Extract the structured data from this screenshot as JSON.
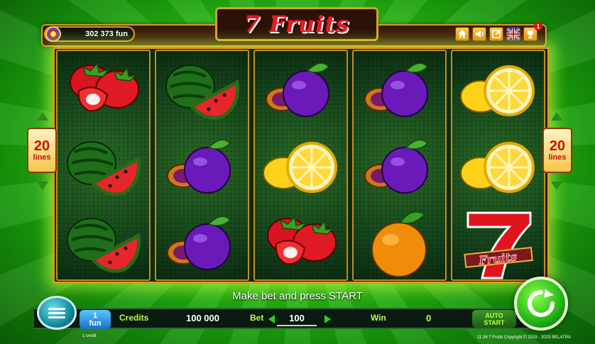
{
  "game": {
    "logo": "7 Fruits",
    "balance": "302 373 fun"
  },
  "toolbar": {
    "icons": [
      "home-icon",
      "sound-icon",
      "fullscreen-icon",
      "flag-uk-icon",
      "trophy-icon"
    ],
    "trophy_badge": "1"
  },
  "lines": {
    "left_count": "20",
    "left_label": "lines",
    "right_count": "20",
    "right_label": "lines"
  },
  "reels": [
    [
      "strawberry",
      "watermelon",
      "watermelon"
    ],
    [
      "watermelon",
      "plum",
      "plum"
    ],
    [
      "plum",
      "lemon",
      "strawberry"
    ],
    [
      "plum",
      "plum",
      "orange"
    ],
    [
      "lemon",
      "lemon",
      "seven"
    ]
  ],
  "message": "Make bet and press START",
  "bottom": {
    "coin_value": "1",
    "coin_unit": "fun",
    "credits_label": "Credits",
    "credits_value": "100 000",
    "bet_label": "Bet",
    "bet_value": "100",
    "win_label": "Win",
    "win_value": "0",
    "auto_start_line1": "AUTO",
    "auto_start_line2": "START"
  },
  "footer": {
    "left": "1 credit",
    "right": "11:34  7 Fruits Copyright © 2019 - 2023  BELATRA"
  },
  "colors": {
    "background": "#3fd21a",
    "frame": "#d69a26",
    "label_green": "#b8ff40",
    "lines_red": "#c1150b"
  }
}
